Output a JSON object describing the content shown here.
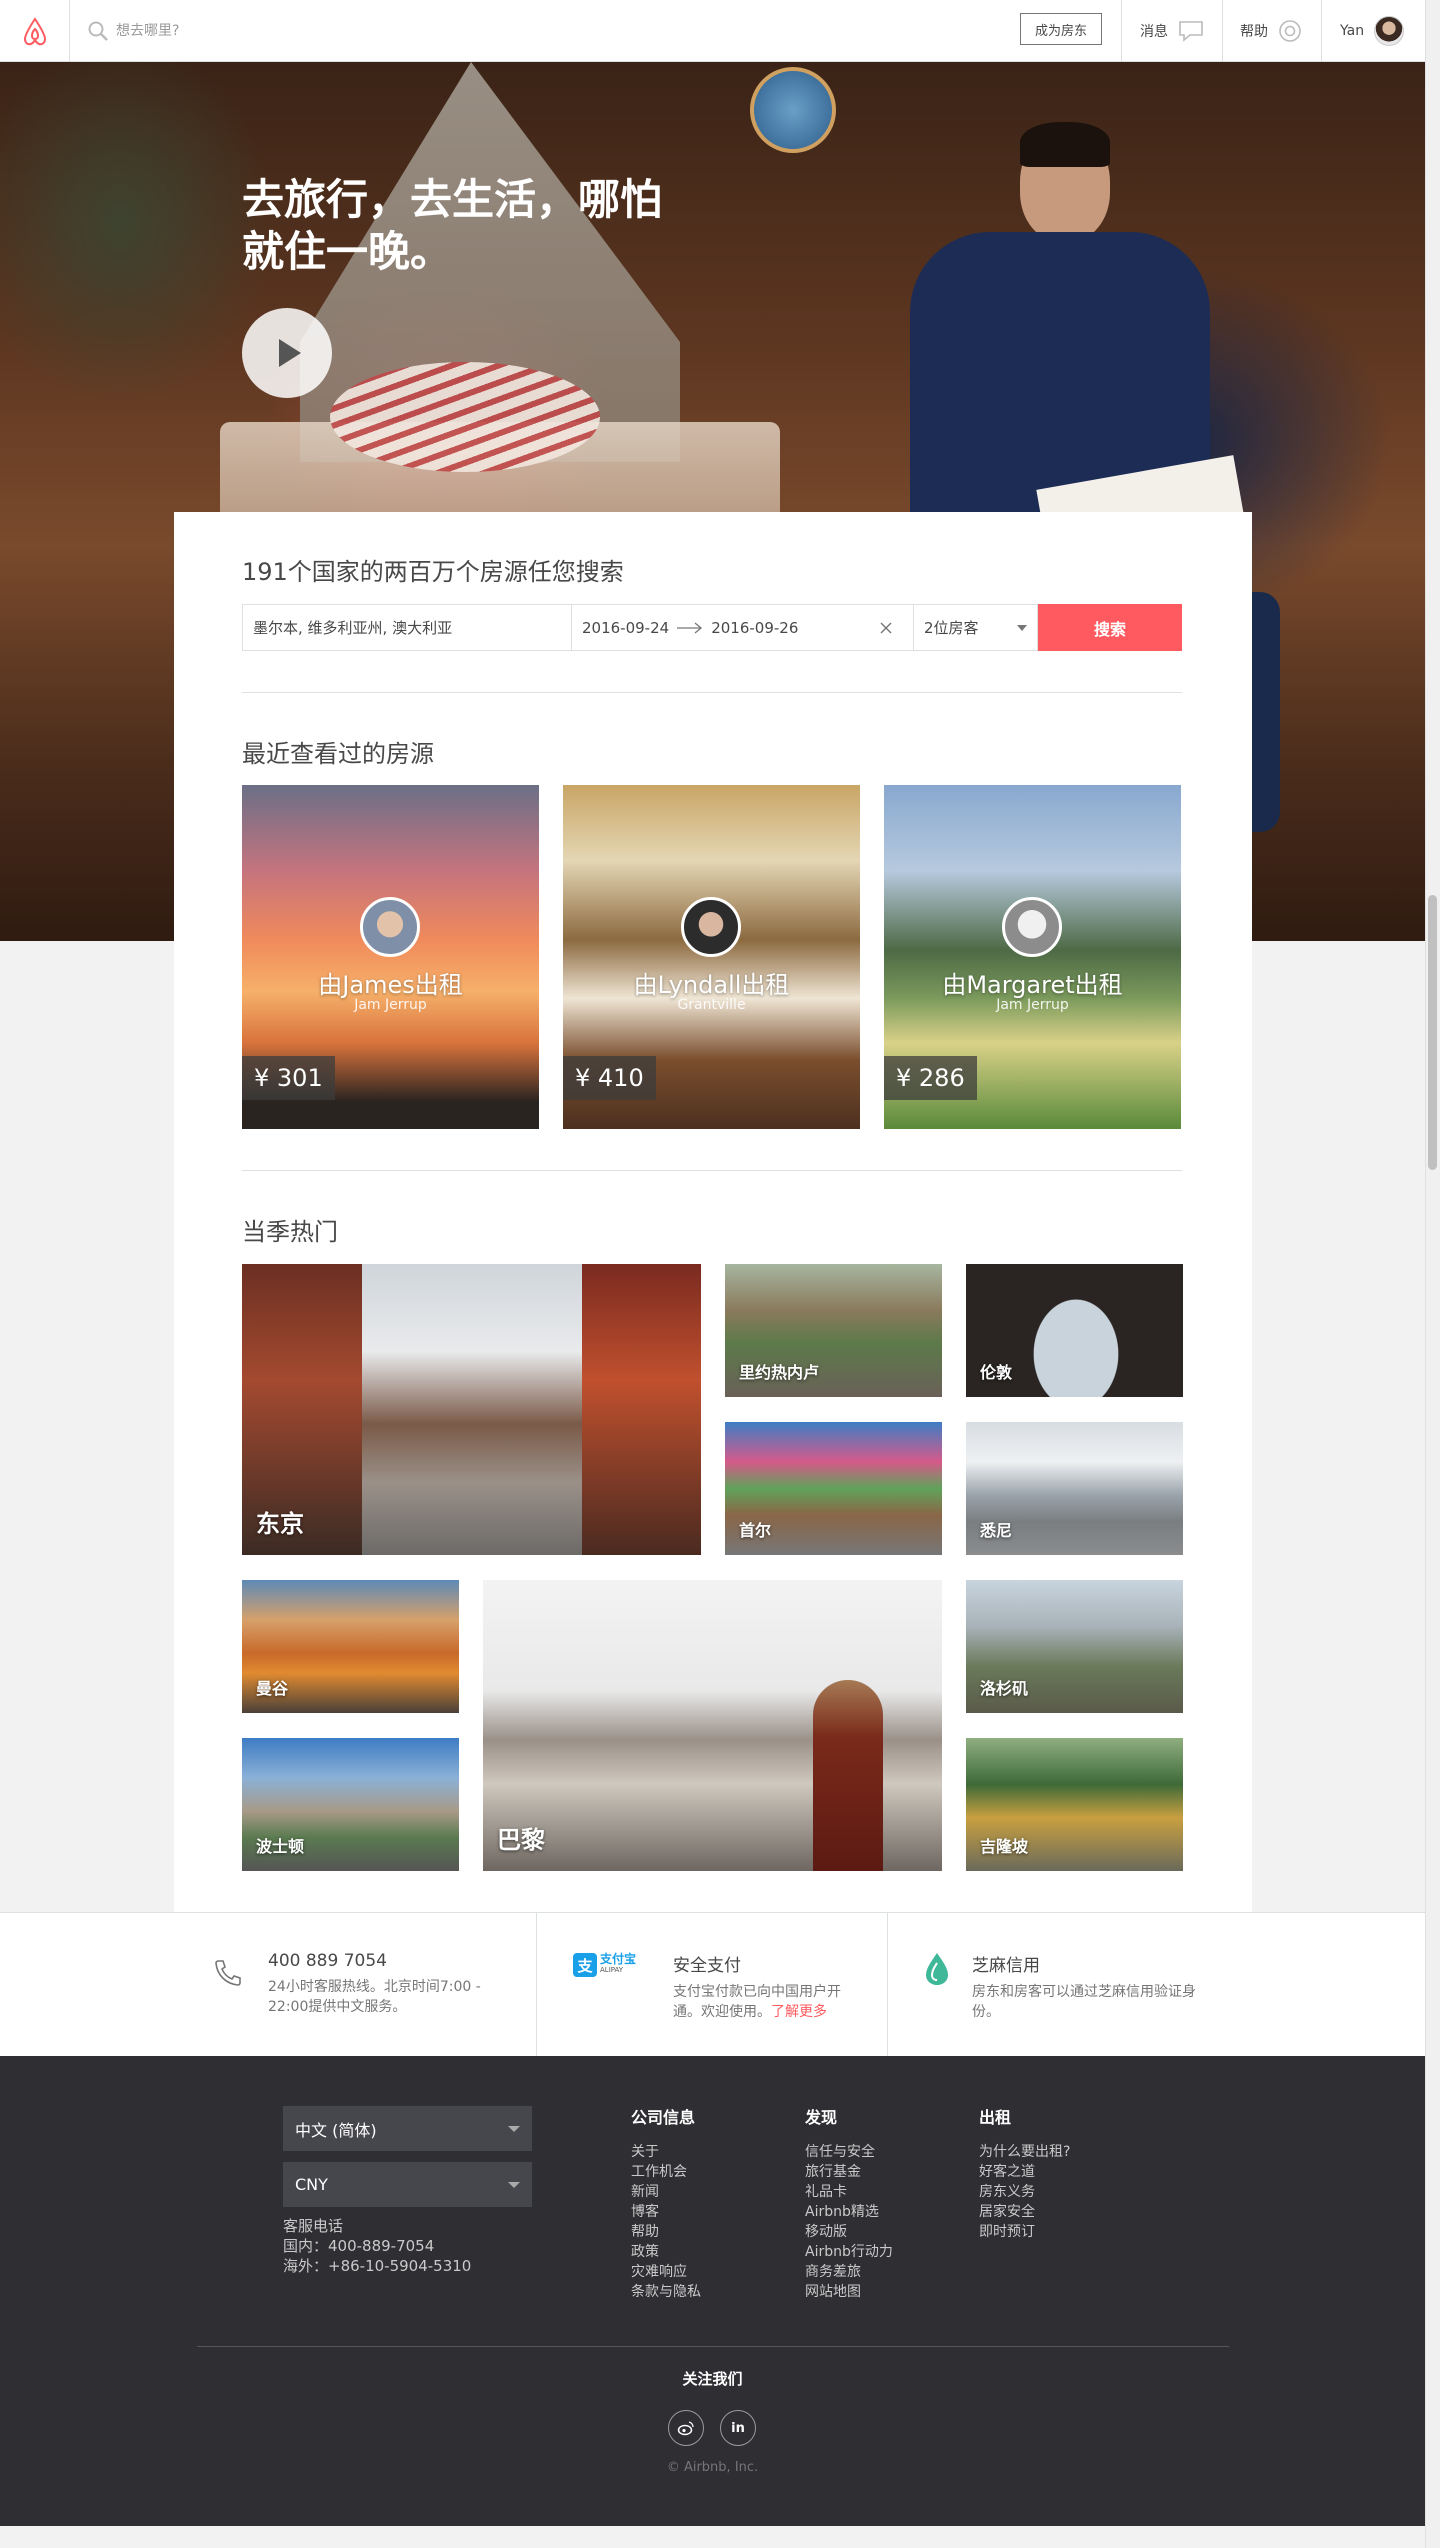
{
  "header": {
    "search_placeholder": "想去哪里?",
    "become_host": "成为房东",
    "messages": "消息",
    "help": "帮助",
    "user_name": "Yan"
  },
  "hero": {
    "title": "去旅行，去生活，哪怕就住一晚。"
  },
  "search": {
    "title": "191个国家的两百万个房源任您搜索",
    "location_value": "墨尔本, 维多利亚州, 澳大利亚",
    "checkin": "2016-09-24",
    "checkout": "2016-09-26",
    "guests": "2位房客",
    "button": "搜索"
  },
  "recent": {
    "title": "最近查看过的房源",
    "cards": [
      {
        "owner": "由James出租",
        "subtitle": "Jam Jerrup",
        "price": "¥ 301"
      },
      {
        "owner": "由Lyndall出租",
        "subtitle": "Grantville",
        "price": "¥ 410"
      },
      {
        "owner": "由Margaret出租",
        "subtitle": "Jam Jerrup",
        "price": "¥ 286"
      }
    ]
  },
  "popular": {
    "title": "当季热门",
    "cities": [
      "东京",
      "里约热内卢",
      "伦敦",
      "首尔",
      "悉尼",
      "曼谷",
      "巴黎",
      "洛杉矶",
      "波士顿",
      "吉隆坡"
    ]
  },
  "trust": {
    "phone": {
      "title": "400 889 7054",
      "desc": "24小时客服热线。北京时间7:00 - 22:00提供中文服务。"
    },
    "alipay": {
      "logo_text": "支付宝",
      "logo_sub": "ALIPAY",
      "title": "安全支付",
      "desc": "支付宝付款已向中国用户开通。欢迎使用。",
      "link": "了解更多"
    },
    "sesame": {
      "title": "芝麻信用",
      "desc": "房东和房客可以通过芝麻信用验证身份。"
    }
  },
  "footer": {
    "language": "中文 (简体)",
    "currency": "CNY",
    "service_label": "客服电话",
    "domestic": "国内：400-889-7054",
    "overseas": "海外：+86-10-5904-5310",
    "columns": [
      {
        "title": "公司信息",
        "links": [
          "关于",
          "工作机会",
          "新闻",
          "博客",
          "帮助",
          "政策",
          "灾难响应",
          "条款与隐私"
        ]
      },
      {
        "title": "发现",
        "links": [
          "信任与安全",
          "旅行基金",
          "礼品卡",
          "Airbnb精选",
          "移动版",
          "Airbnb行动力",
          "商务差旅",
          "网站地图"
        ]
      },
      {
        "title": "出租",
        "links": [
          "为什么要出租?",
          "好客之道",
          "房东义务",
          "居家安全",
          "即时预订"
        ]
      }
    ],
    "follow": "关注我们",
    "social": [
      "weibo",
      "in"
    ],
    "copyright": "© Airbnb, Inc."
  },
  "colors": {
    "brand": "#ff5a5f",
    "footer_bg": "#2e2e33",
    "text": "#484848"
  }
}
